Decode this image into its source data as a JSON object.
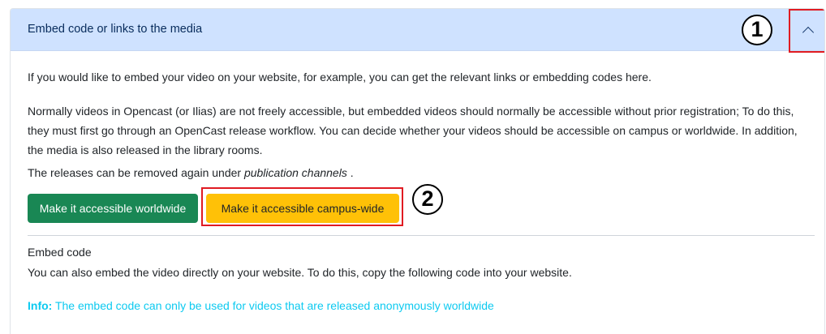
{
  "header": {
    "title": "Embed code or links to the media",
    "collapse_icon": "chevron-up-icon"
  },
  "annotations": {
    "step1": "1",
    "step2": "2",
    "highlight_color": "#e01b22"
  },
  "body": {
    "intro": "If you would like to embed your video on your website, for example, you can get the relevant links or embedding codes here.",
    "normal_access": "Normally videos in Opencast (or Ilias) are not freely accessible, but embedded videos should normally be accessible without prior registration; To do this, they must first go through an OpenCast release workflow. You can decide whether your videos should be accessible on campus or worldwide. In addition, the media is also released in the library rooms.",
    "releases_prefix": "The releases can be removed again under ",
    "releases_link": "publication channels",
    "releases_suffix": " ."
  },
  "buttons": {
    "worldwide": "Make it accessible worldwide",
    "campus": "Make it accessible campus-wide",
    "worldwide_color": "#198754",
    "campus_color": "#ffc107"
  },
  "embed": {
    "title": "Embed code",
    "description": "You can also embed the video directly on your website. To do this, copy the following code into your website.",
    "info_label": "Info:",
    "info_text": " The embed code can only be used for videos that are released anonymously worldwide"
  },
  "colors": {
    "header_bg": "#cfe2ff",
    "info": "#0dcaf0"
  }
}
